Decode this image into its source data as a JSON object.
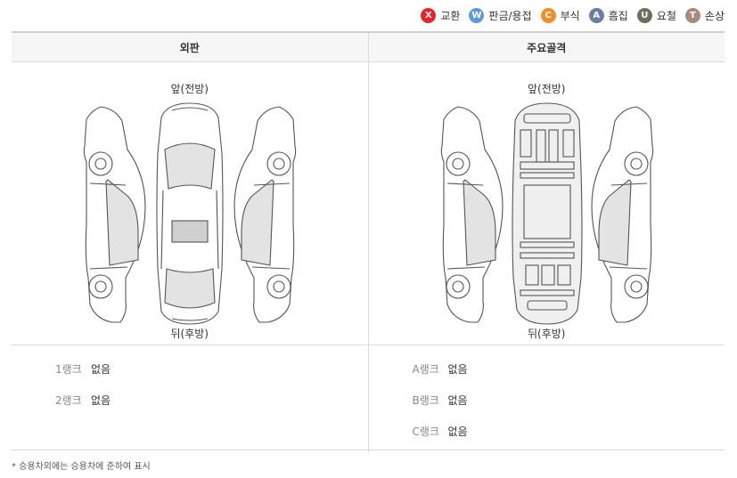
{
  "legend": [
    {
      "code": "X",
      "label": "교환",
      "color": "#e8252e",
      "icon": "x-badge-icon"
    },
    {
      "code": "W",
      "label": "판금/용접",
      "color": "#5c9ad8",
      "icon": "w-badge-icon"
    },
    {
      "code": "C",
      "label": "부식",
      "color": "#ef8f2a",
      "icon": "c-badge-icon"
    },
    {
      "code": "A",
      "label": "흠집",
      "color": "#6b7ea3",
      "icon": "a-badge-icon"
    },
    {
      "code": "U",
      "label": "요철",
      "color": "#6f6e5a",
      "icon": "u-badge-icon"
    },
    {
      "code": "T",
      "label": "손상",
      "color": "#a88a7a",
      "icon": "t-badge-icon"
    }
  ],
  "columns": {
    "exterior": "외판",
    "frame": "주요골격"
  },
  "diagram": {
    "front": "앞(전방)",
    "rear": "뒤(후방)"
  },
  "exterior_ranks": [
    {
      "label": "1랭크",
      "value": "없음"
    },
    {
      "label": "2랭크",
      "value": "없음"
    }
  ],
  "frame_ranks": [
    {
      "label": "A랭크",
      "value": "없음"
    },
    {
      "label": "B랭크",
      "value": "없음"
    },
    {
      "label": "C랭크",
      "value": "없음"
    }
  ],
  "footnote": "* 승용차외에는 승용차에 준하여 표시"
}
